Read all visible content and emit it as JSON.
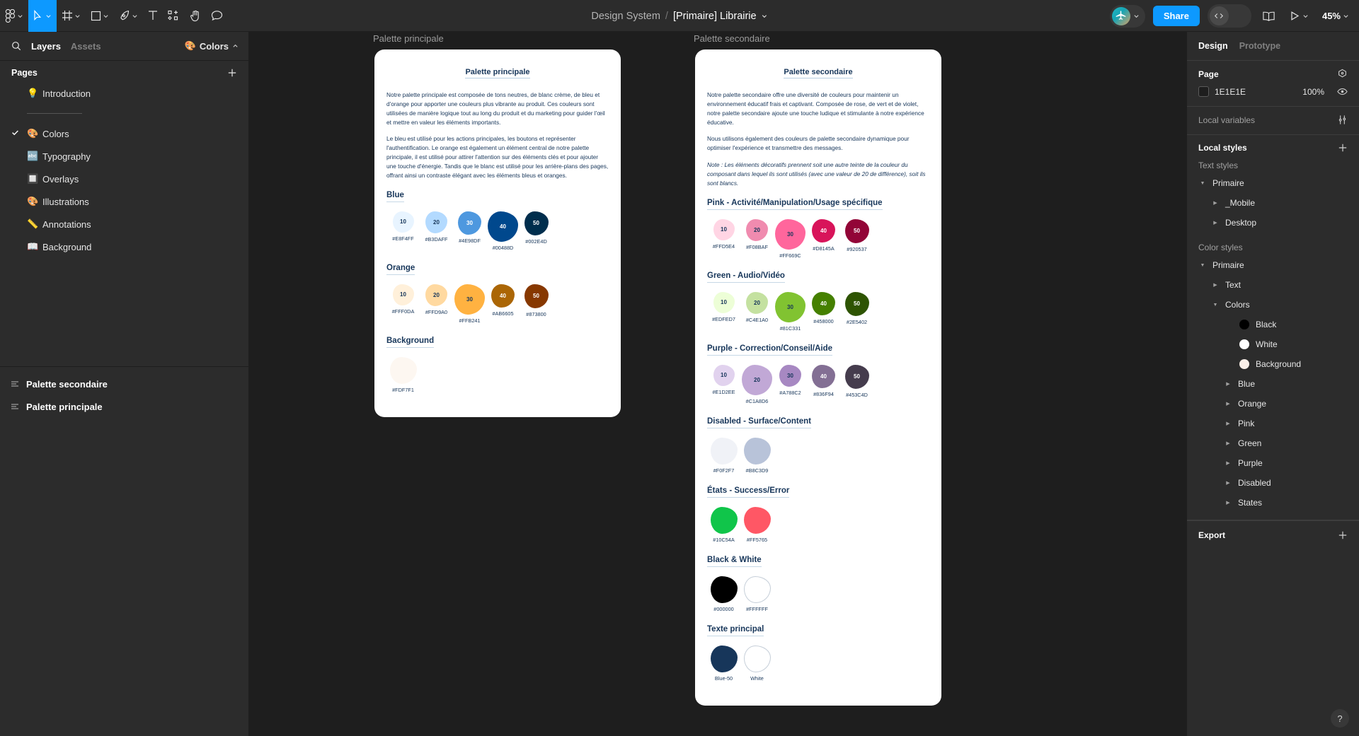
{
  "toolbar": {
    "tools": [
      {
        "name": "figma-logo-icon",
        "caret": true
      },
      {
        "name": "move-tool-icon",
        "caret": true,
        "active": true
      },
      {
        "name": "frame-tool-icon",
        "caret": true
      },
      {
        "name": "shape-tool-icon",
        "caret": true
      },
      {
        "name": "pen-tool-icon",
        "caret": true
      },
      {
        "name": "text-tool-icon",
        "caret": false
      },
      {
        "name": "components-tool-icon",
        "caret": false
      },
      {
        "name": "hand-tool-icon",
        "caret": false
      },
      {
        "name": "comment-tool-icon",
        "caret": false
      }
    ],
    "project_name": "Design System",
    "separator": "/",
    "file_name": "[Primaire] Librairie",
    "share_label": "Share",
    "code_label": "</>",
    "zoom_level": "45%"
  },
  "left_panel": {
    "tabs": [
      {
        "label": "Layers",
        "active": true
      },
      {
        "label": "Assets",
        "active": false
      }
    ],
    "page_chip": {
      "emoji": "🎨",
      "label": "Colors"
    },
    "pages_title": "Pages",
    "pages": [
      {
        "emoji": "💡",
        "label": "Introduction",
        "selected": false
      },
      {
        "divider": true
      },
      {
        "emoji": "🎨",
        "label": "Colors",
        "selected": true
      },
      {
        "emoji": "🔤",
        "label": "Typography",
        "selected": false
      },
      {
        "emoji": "🔲",
        "label": "Overlays",
        "selected": false
      },
      {
        "emoji": "🎨",
        "label": "Illustrations",
        "selected": false
      },
      {
        "emoji": "📏",
        "label": "Annotations",
        "selected": false
      },
      {
        "emoji": "📖",
        "label": "Background",
        "selected": false
      }
    ],
    "layers": [
      {
        "label": "Palette secondaire"
      },
      {
        "label": "Palette principale"
      }
    ]
  },
  "canvas": {
    "frames": [
      {
        "label": "Palette principale",
        "title": "Palette principale",
        "paragraphs": [
          {
            "text": "Notre palette principale est composée de tons neutres, de blanc crème, de bleu et d'orange pour apporter une couleurs plus vibrante au produit. Ces couleurs sont utilisées de manière logique tout au long du produit et du marketing pour guider l'œil et mettre en valeur les éléments importants.",
            "italic": false
          },
          {
            "text": "Le bleu est utilisé pour les actions principales, les boutons et représenter l'authentification. Le orange est également un élément central de notre palette principale, il est utilisé pour attirer l'attention sur des éléments clés et pour ajouter une touche d'énergie. Tandis que le blanc est utilisé pour les arrière-plans des pages, offrant ainsi un contraste élégant avec les éléments bleus et oranges.",
            "italic": false
          }
        ],
        "sections": [
          {
            "heading": "Blue",
            "swatches": [
              {
                "step": "10",
                "hex": "#E8F4FF",
                "size": 30,
                "text": "#17365a"
              },
              {
                "step": "20",
                "hex": "#B3DAFF",
                "size": 31,
                "text": "#17365a"
              },
              {
                "step": "30",
                "hex": "#4E98DF",
                "size": 33,
                "text": "#ffffff"
              },
              {
                "step": "40",
                "hex": "#00488D",
                "size": 43,
                "text": "#ffffff"
              },
              {
                "step": "50",
                "hex": "#002E4D",
                "size": 34,
                "text": "#ffffff"
              }
            ]
          },
          {
            "heading": "Orange",
            "swatches": [
              {
                "step": "10",
                "hex": "#FFF0DA",
                "size": 30,
                "text": "#17365a"
              },
              {
                "step": "20",
                "hex": "#FFD9A0",
                "size": 31,
                "text": "#17365a"
              },
              {
                "step": "30",
                "hex": "#FFB241",
                "size": 43,
                "text": "#17365a"
              },
              {
                "step": "40",
                "hex": "#AB6605",
                "size": 33,
                "text": "#ffffff"
              },
              {
                "step": "50",
                "hex": "#873800",
                "size": 34,
                "text": "#ffffff"
              }
            ]
          },
          {
            "heading": "Background",
            "swatches": [
              {
                "step": "",
                "hex": "#FDF7F1",
                "size": 38,
                "text": "#17365a"
              }
            ]
          }
        ]
      },
      {
        "label": "Palette secondaire",
        "title": "Palette secondaire",
        "paragraphs": [
          {
            "text": "Notre palette secondaire offre une diversité de couleurs pour maintenir un environnement éducatif frais et captivant. Composée de rose, de vert et de violet, notre palette secondaire ajoute une touche ludique et stimulante à notre expérience éducative.",
            "italic": false
          },
          {
            "text": "Nous utilisons également des couleurs de palette secondaire dynamique pour optimiser l'expérience et transmettre des messages.",
            "italic": false
          },
          {
            "text": "Note : Les éléments décoratifs prennent soit une autre teinte de la couleur du composant dans lequel ils sont utilisés (avec une valeur de 20 de différence), soit ils sont blancs.",
            "italic": true
          }
        ],
        "sections": [
          {
            "heading": "Pink - Activité/Manipulation/Usage spécifique",
            "swatches": [
              {
                "step": "10",
                "hex": "#FFD5E4",
                "size": 30,
                "text": "#17365a"
              },
              {
                "step": "20",
                "hex": "#F08BAF",
                "size": 31,
                "text": "#17365a"
              },
              {
                "step": "30",
                "hex": "#FF669C",
                "size": 43,
                "text": "#17365a"
              },
              {
                "step": "40",
                "hex": "#D8145A",
                "size": 33,
                "text": "#ffffff"
              },
              {
                "step": "50",
                "hex": "#920537",
                "size": 34,
                "text": "#ffffff"
              }
            ]
          },
          {
            "heading": "Green - Audio/Vidéo",
            "swatches": [
              {
                "step": "10",
                "hex": "#EDFED7",
                "size": 30,
                "text": "#17365a"
              },
              {
                "step": "20",
                "hex": "#C4E1A0",
                "size": 31,
                "text": "#17365a"
              },
              {
                "step": "30",
                "hex": "#81C331",
                "size": 43,
                "text": "#17365a"
              },
              {
                "step": "40",
                "hex": "#458000",
                "size": 33,
                "text": "#ffffff"
              },
              {
                "step": "50",
                "hex": "#2E5402",
                "size": 34,
                "text": "#ffffff"
              }
            ]
          },
          {
            "heading": "Purple - Correction/Conseil/Aide",
            "swatches": [
              {
                "step": "10",
                "hex": "#E1D2EE",
                "size": 30,
                "text": "#17365a"
              },
              {
                "step": "20",
                "hex": "#C1A8D6",
                "size": 43,
                "text": "#17365a"
              },
              {
                "step": "30",
                "hex": "#A788C2",
                "size": 31,
                "text": "#17365a"
              },
              {
                "step": "40",
                "hex": "#836F94",
                "size": 33,
                "text": "#ffffff"
              },
              {
                "step": "50",
                "hex": "#453C4D",
                "size": 34,
                "text": "#ffffff"
              }
            ]
          },
          {
            "heading": "Disabled - Surface/Content",
            "swatches": [
              {
                "step": "",
                "hex": "#F0F2F7",
                "size": 38,
                "text": "#17365a"
              },
              {
                "step": "",
                "hex": "#B8C3D9",
                "size": 38,
                "text": "#17365a"
              }
            ]
          },
          {
            "heading": "États - Success/Error",
            "swatches": [
              {
                "step": "",
                "hex": "#10C54A",
                "size": 38,
                "text": "#ffffff"
              },
              {
                "step": "",
                "hex": "#FF5765",
                "size": 38,
                "text": "#ffffff"
              }
            ]
          },
          {
            "heading": "Black & White",
            "swatches": [
              {
                "step": "",
                "hex": "#000000",
                "size": 38,
                "text": "#ffffff"
              },
              {
                "step": "",
                "hex": "#FFFFFF",
                "size": 38,
                "text": "#17365a",
                "border": true
              }
            ]
          },
          {
            "heading": "Texte principal",
            "swatches": [
              {
                "step": "",
                "hex": "#17365a",
                "label": "Blue-50",
                "size": 38,
                "text": "#ffffff"
              },
              {
                "step": "",
                "hex": "#FFFFFF",
                "label": "White",
                "size": 38,
                "text": "#17365a",
                "border": true
              }
            ]
          }
        ]
      }
    ]
  },
  "right_panel": {
    "tabs": [
      {
        "label": "Design",
        "active": true
      },
      {
        "label": "Prototype",
        "active": false
      }
    ],
    "page": {
      "title": "Page",
      "color_hex": "1E1E1E",
      "opacity": "100%"
    },
    "local_variables": {
      "label": "Local variables"
    },
    "local_styles": {
      "label": "Local styles"
    },
    "text_styles": {
      "label": "Text styles",
      "tree": [
        {
          "label": "Primaire",
          "depth": 0,
          "arrow": "down"
        },
        {
          "label": "_Mobile",
          "depth": 1,
          "arrow": "right"
        },
        {
          "label": "Desktop",
          "depth": 1,
          "arrow": "right"
        }
      ]
    },
    "color_styles": {
      "label": "Color styles",
      "tree": [
        {
          "label": "Primaire",
          "depth": 0,
          "arrow": "down"
        },
        {
          "label": "Text",
          "depth": 1,
          "arrow": "right"
        },
        {
          "label": "Colors",
          "depth": 1,
          "arrow": "down"
        },
        {
          "label": "Black",
          "depth": 2,
          "swatch": "#000000"
        },
        {
          "label": "White",
          "depth": 2,
          "swatch": "#FFFFFF"
        },
        {
          "label": "Background",
          "depth": 2,
          "swatch": "#FAEFE8"
        },
        {
          "label": "Blue",
          "depth": 2,
          "arrow": "right"
        },
        {
          "label": "Orange",
          "depth": 2,
          "arrow": "right"
        },
        {
          "label": "Pink",
          "depth": 2,
          "arrow": "right"
        },
        {
          "label": "Green",
          "depth": 2,
          "arrow": "right"
        },
        {
          "label": "Purple",
          "depth": 2,
          "arrow": "right"
        },
        {
          "label": "Disabled",
          "depth": 2,
          "arrow": "right"
        },
        {
          "label": "States",
          "depth": 2,
          "arrow": "right"
        }
      ]
    },
    "export": {
      "label": "Export"
    },
    "help_label": "?"
  }
}
